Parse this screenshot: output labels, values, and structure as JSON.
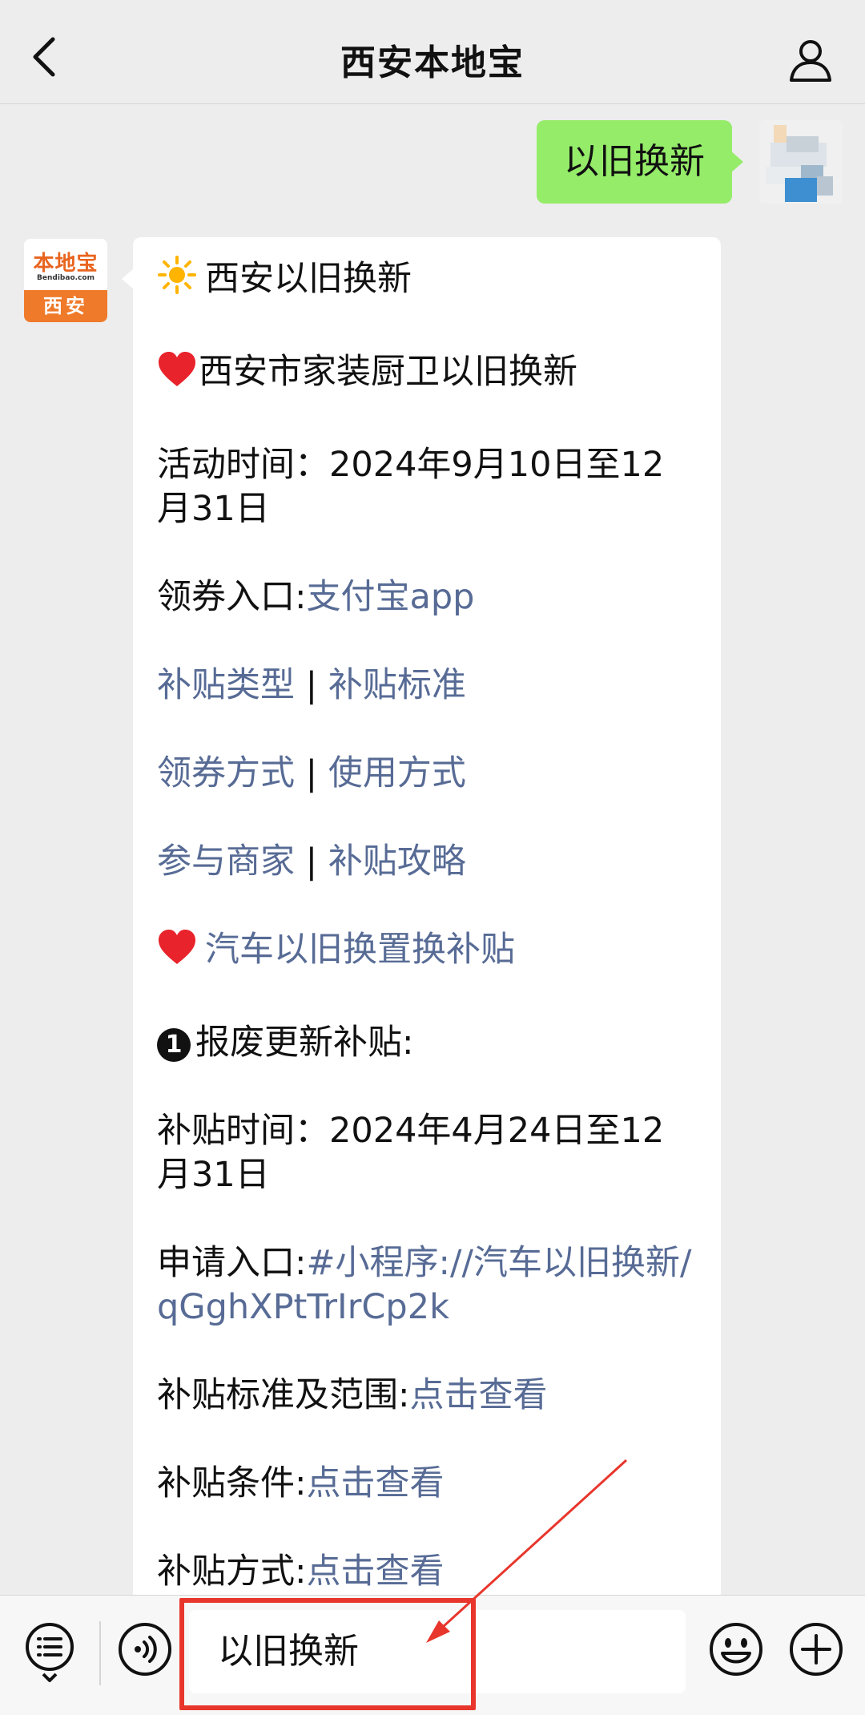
{
  "header": {
    "title": "西安本地宝"
  },
  "sent_message": {
    "text": "以旧换新"
  },
  "brand_avatar": {
    "name": "本地宝",
    "site": "Bendibao.com",
    "city": "西安"
  },
  "reply": {
    "heading": "西安以旧换新",
    "section1_title": "西安市家装厨卫以旧换新",
    "activity_time_label": "活动时间：",
    "activity_time_value": "2024年9月10日至12月31日",
    "coupon_entry_label": "领券入口:",
    "coupon_entry_link": "支付宝app",
    "link_subsidy_type": "补贴类型",
    "link_subsidy_standard": "补贴标准",
    "link_coupon_method": "领券方式",
    "link_usage_method": "使用方式",
    "link_merchants": "参与商家",
    "link_subsidy_guide": "补贴攻略",
    "separator": "|",
    "section2_title": "汽车以旧换置换补贴",
    "scrap_number": "1",
    "scrap_title": "报废更新补贴:",
    "subsidy_time_label": "补贴时间：",
    "subsidy_time_value": "2024年4月24日至12月31日",
    "apply_entry_label": "申请入口:",
    "apply_entry_link": "#小程序://汽车以旧换新/qGghXPtTrIrCp2k",
    "standard_scope_label": "补贴标准及范围:",
    "conditions_label": "补贴条件:",
    "method_label": "补贴方式:",
    "view_link": "点击查看"
  },
  "input_bar": {
    "text_value": "以旧换新"
  },
  "colors": {
    "link": "#576b95",
    "sent_bubble": "#95ec69",
    "annotation": "#e8362c"
  }
}
